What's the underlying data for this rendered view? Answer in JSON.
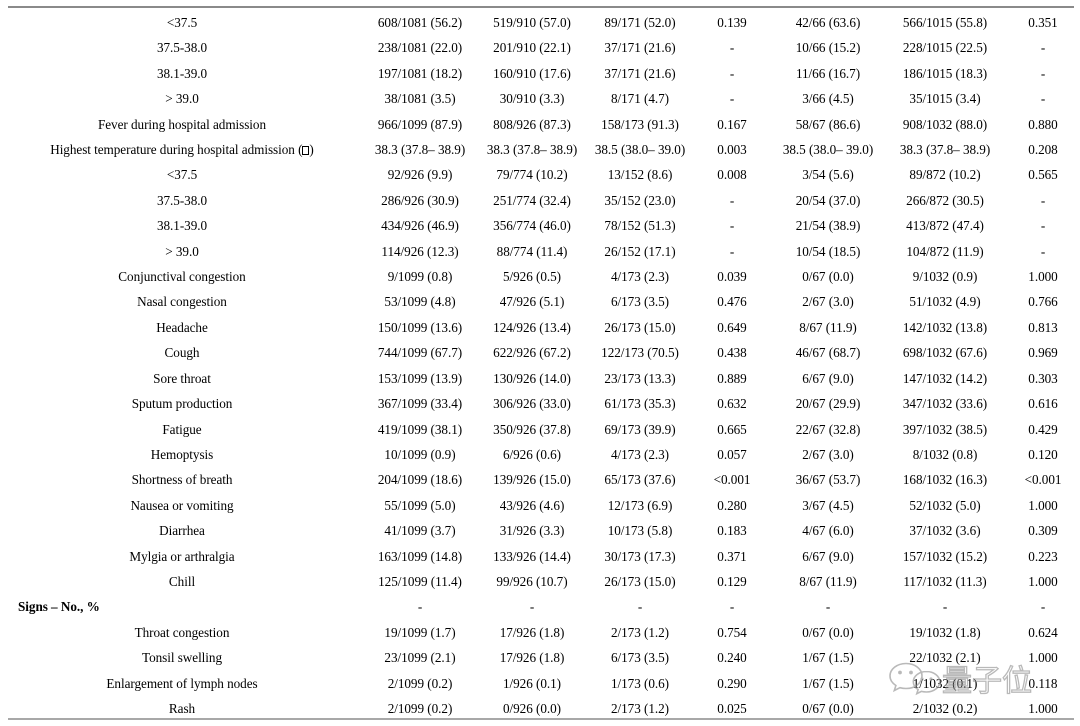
{
  "document": {
    "type": "scientific-table-continued",
    "title_visible": false,
    "row_count": 28,
    "column_count": 8
  },
  "columns": [
    {
      "key": "label",
      "align": "center"
    },
    {
      "key": "total",
      "align": "center"
    },
    {
      "key": "non_severe",
      "align": "center"
    },
    {
      "key": "severe",
      "align": "center"
    },
    {
      "key": "p_value_1",
      "align": "center"
    },
    {
      "key": "endpoint",
      "align": "center"
    },
    {
      "key": "no_endpoint",
      "align": "center"
    },
    {
      "key": "p_value_2",
      "align": "center"
    }
  ],
  "symbols": {
    "dash": "-",
    "less_than_0001": "<0.001",
    "degree_celsius_missing_glyph": "□"
  },
  "rows": [
    {
      "label": "<37.5",
      "indent": "sub",
      "bold": false,
      "cells": [
        "608/1081 (56.2)",
        "519/910 (57.0)",
        "89/171 (52.0)",
        "0.139",
        "42/66 (63.6)",
        "566/1015 (55.8)",
        "0.351"
      ]
    },
    {
      "label": "37.5-38.0",
      "indent": "sub",
      "bold": false,
      "cells": [
        "238/1081 (22.0)",
        "201/910 (22.1)",
        "37/171 (21.6)",
        "-",
        "10/66 (15.2)",
        "228/1015 (22.5)",
        "-"
      ]
    },
    {
      "label": "38.1-39.0",
      "indent": "sub",
      "bold": false,
      "cells": [
        "197/1081 (18.2)",
        "160/910 (17.6)",
        "37/171 (21.6)",
        "-",
        "11/66 (16.7)",
        "186/1015 (18.3)",
        "-"
      ]
    },
    {
      "label": "> 39.0",
      "indent": "sub",
      "bold": false,
      "cells": [
        "38/1081 (3.5)",
        "30/910 (3.3)",
        "8/171 (4.7)",
        "-",
        "3/66 (4.5)",
        "35/1015 (3.4)",
        "-"
      ]
    },
    {
      "label": "Fever during hospital admission",
      "indent": "item",
      "bold": false,
      "cells": [
        "966/1099 (87.9)",
        "808/926 (87.3)",
        "158/173 (91.3)",
        "0.167",
        "58/67 (86.6)",
        "908/1032 (88.0)",
        "0.880"
      ]
    },
    {
      "label": "Highest temperature during hospital admission (□)",
      "indent": "item",
      "bold": false,
      "cells": [
        "38.3 (37.8– 38.9)",
        "38.3 (37.8– 38.9)",
        "38.5 (38.0– 39.0)",
        "0.003",
        "38.5 (38.0– 39.0)",
        "38.3 (37.8– 38.9)",
        "0.208"
      ]
    },
    {
      "label": "<37.5",
      "indent": "sub",
      "bold": false,
      "cells": [
        "92/926 (9.9)",
        "79/774 (10.2)",
        "13/152 (8.6)",
        "0.008",
        "3/54 (5.6)",
        "89/872 (10.2)",
        "0.565"
      ]
    },
    {
      "label": "37.5-38.0",
      "indent": "sub",
      "bold": false,
      "cells": [
        "286/926 (30.9)",
        "251/774 (32.4)",
        "35/152 (23.0)",
        "-",
        "20/54 (37.0)",
        "266/872 (30.5)",
        "-"
      ]
    },
    {
      "label": "38.1-39.0",
      "indent": "sub",
      "bold": false,
      "cells": [
        "434/926 (46.9)",
        "356/774 (46.0)",
        "78/152 (51.3)",
        "-",
        "21/54 (38.9)",
        "413/872 (47.4)",
        "-"
      ]
    },
    {
      "label": "> 39.0",
      "indent": "sub",
      "bold": false,
      "cells": [
        "114/926 (12.3)",
        "88/774 (11.4)",
        "26/152 (17.1)",
        "-",
        "10/54 (18.5)",
        "104/872 (11.9)",
        "-"
      ]
    },
    {
      "label": "Conjunctival congestion",
      "indent": "item",
      "bold": false,
      "cells": [
        "9/1099 (0.8)",
        "5/926 (0.5)",
        "4/173 (2.3)",
        "0.039",
        "0/67 (0.0)",
        "9/1032 (0.9)",
        "1.000"
      ]
    },
    {
      "label": "Nasal congestion",
      "indent": "item",
      "bold": false,
      "cells": [
        "53/1099 (4.8)",
        "47/926 (5.1)",
        "6/173 (3.5)",
        "0.476",
        "2/67 (3.0)",
        "51/1032 (4.9)",
        "0.766"
      ]
    },
    {
      "label": "Headache",
      "indent": "item",
      "bold": false,
      "cells": [
        "150/1099 (13.6)",
        "124/926 (13.4)",
        "26/173 (15.0)",
        "0.649",
        "8/67 (11.9)",
        "142/1032 (13.8)",
        "0.813"
      ]
    },
    {
      "label": "Cough",
      "indent": "item",
      "bold": false,
      "cells": [
        "744/1099 (67.7)",
        "622/926 (67.2)",
        "122/173 (70.5)",
        "0.438",
        "46/67 (68.7)",
        "698/1032 (67.6)",
        "0.969"
      ]
    },
    {
      "label": "Sore throat",
      "indent": "item",
      "bold": false,
      "cells": [
        "153/1099 (13.9)",
        "130/926 (14.0)",
        "23/173 (13.3)",
        "0.889",
        "6/67 (9.0)",
        "147/1032 (14.2)",
        "0.303"
      ]
    },
    {
      "label": "Sputum production",
      "indent": "item",
      "bold": false,
      "cells": [
        "367/1099 (33.4)",
        "306/926 (33.0)",
        "61/173 (35.3)",
        "0.632",
        "20/67 (29.9)",
        "347/1032 (33.6)",
        "0.616"
      ]
    },
    {
      "label": "Fatigue",
      "indent": "item",
      "bold": false,
      "cells": [
        "419/1099 (38.1)",
        "350/926 (37.8)",
        "69/173 (39.9)",
        "0.665",
        "22/67 (32.8)",
        "397/1032 (38.5)",
        "0.429"
      ]
    },
    {
      "label": "Hemoptysis",
      "indent": "item",
      "bold": false,
      "cells": [
        "10/1099 (0.9)",
        "6/926 (0.6)",
        "4/173 (2.3)",
        "0.057",
        "2/67 (3.0)",
        "8/1032 (0.8)",
        "0.120"
      ]
    },
    {
      "label": "Shortness of breath",
      "indent": "item",
      "bold": false,
      "cells": [
        "204/1099 (18.6)",
        "139/926 (15.0)",
        "65/173 (37.6)",
        "<0.001",
        "36/67 (53.7)",
        "168/1032 (16.3)",
        "<0.001"
      ]
    },
    {
      "label": "Nausea or vomiting",
      "indent": "item",
      "bold": false,
      "cells": [
        "55/1099 (5.0)",
        "43/926 (4.6)",
        "12/173 (6.9)",
        "0.280",
        "3/67 (4.5)",
        "52/1032 (5.0)",
        "1.000"
      ]
    },
    {
      "label": "Diarrhea",
      "indent": "item",
      "bold": false,
      "cells": [
        "41/1099 (3.7)",
        "31/926 (3.3)",
        "10/173 (5.8)",
        "0.183",
        "4/67 (6.0)",
        "37/1032 (3.6)",
        "0.309"
      ]
    },
    {
      "label": "Mylgia or arthralgia",
      "indent": "item",
      "bold": false,
      "cells": [
        "163/1099 (14.8)",
        "133/926 (14.4)",
        "30/173 (17.3)",
        "0.371",
        "6/67 (9.0)",
        "157/1032 (15.2)",
        "0.223"
      ]
    },
    {
      "label": "Chill",
      "indent": "item",
      "bold": false,
      "cells": [
        "125/1099 (11.4)",
        "99/926 (10.7)",
        "26/173 (15.0)",
        "0.129",
        "8/67 (11.9)",
        "117/1032 (11.3)",
        "1.000"
      ]
    },
    {
      "label": "Signs – No., %",
      "indent": "section",
      "bold": true,
      "cells": [
        "-",
        "-",
        "-",
        "-",
        "-",
        "-",
        "-"
      ]
    },
    {
      "label": "Throat congestion",
      "indent": "item",
      "bold": false,
      "cells": [
        "19/1099 (1.7)",
        "17/926 (1.8)",
        "2/173 (1.2)",
        "0.754",
        "0/67 (0.0)",
        "19/1032 (1.8)",
        "0.624"
      ]
    },
    {
      "label": "Tonsil swelling",
      "indent": "item",
      "bold": false,
      "cells": [
        "23/1099 (2.1)",
        "17/926 (1.8)",
        "6/173 (3.5)",
        "0.240",
        "1/67 (1.5)",
        "22/1032 (2.1)",
        "1.000"
      ]
    },
    {
      "label": "Enlargement of lymph nodes",
      "indent": "item",
      "bold": false,
      "cells": [
        "2/1099 (0.2)",
        "1/926 (0.1)",
        "1/173 (0.6)",
        "0.290",
        "1/67 (1.5)",
        "1/1032 (0.1)",
        "0.118"
      ]
    },
    {
      "label": "Rash",
      "indent": "item",
      "bold": false,
      "cells": [
        "2/1099 (0.2)",
        "0/926 (0.0)",
        "2/173 (1.2)",
        "0.025",
        "0/67 (0.0)",
        "2/1032 (0.2)",
        "1.000"
      ]
    }
  ],
  "watermark": {
    "text": "量子位",
    "icon": "wechat-icon",
    "color": "#8f8f8f"
  }
}
